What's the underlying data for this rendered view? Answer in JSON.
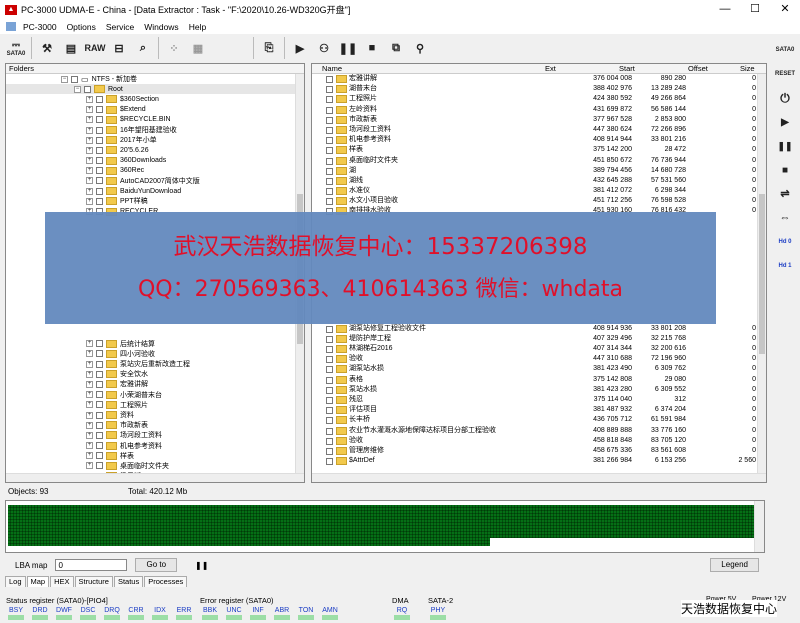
{
  "window": {
    "title": "PC-3000 UDMA-E - China - [Data Extractor : Task - \"F:\\2020\\10.26-WD320G开盘\"]"
  },
  "menu": {
    "items": [
      "PC-3000",
      "Options",
      "Service",
      "Windows",
      "Help"
    ]
  },
  "toolbar": {
    "sata_label": "SATA0",
    "raw_label": "RAW"
  },
  "right_bar": {
    "sata_label": "SATA0",
    "reset_label": "RESET",
    "hd0": "Hd 0",
    "hd1": "Hd 1"
  },
  "folders": {
    "header": "Folders",
    "drive": "NTFS - 新加卷",
    "root": "Root",
    "items_top": [
      "$360Section",
      "$Extend",
      "$RECYCLE.BIN",
      "16年望阳基建验收",
      "2017年小单",
      "20'5.6.26",
      "360Downloads",
      "360Rec",
      "AutoCAD2007简体中文版",
      "BaiduYunDownload",
      "PPT样稿",
      "RECYCLER"
    ],
    "items_bottom": [
      "后统计结算",
      "四小河验收",
      "泵站灾后重新改造工程",
      "安全饮水",
      "宏雅讲解",
      "小荣湖普末台",
      "工程照片",
      "资料",
      "市政新表",
      "场河段工资料",
      "机电参考资料",
      "样表",
      "桌面临时文件夹",
      "梁子湖"
    ]
  },
  "files": {
    "columns": {
      "name": "Name",
      "ext": "Ext",
      "start": "Start",
      "offset": "Offset",
      "size": "Size"
    },
    "rows_top": [
      {
        "name": "宏雅讲解",
        "start": "376 004 008",
        "offset": "890 280",
        "size": "0"
      },
      {
        "name": "湖普末台",
        "start": "388 402 976",
        "offset": "13 289 248",
        "size": "0"
      },
      {
        "name": "工程照片",
        "start": "424 380 592",
        "offset": "49 266 864",
        "size": "0"
      },
      {
        "name": "左岭资料",
        "start": "431 699 872",
        "offset": "56 586 144",
        "size": "0"
      },
      {
        "name": "市政新表",
        "start": "377 967 528",
        "offset": "2 853 800",
        "size": "0"
      },
      {
        "name": "场河段工资料",
        "start": "447 380 624",
        "offset": "72 266 896",
        "size": "0"
      },
      {
        "name": "机电参考资料",
        "start": "408 914 944",
        "offset": "33 801 216",
        "size": "0"
      },
      {
        "name": "样表",
        "start": "375 142 200",
        "offset": "28 472",
        "size": "0"
      },
      {
        "name": "桌面临时文件夹",
        "start": "451 850 672",
        "offset": "76 736 944",
        "size": "0"
      },
      {
        "name": "湖",
        "start": "389 794 456",
        "offset": "14 680 728",
        "size": "0"
      },
      {
        "name": "湖线",
        "start": "432 645 288",
        "offset": "57 531 560",
        "size": "0"
      },
      {
        "name": "水准仪",
        "start": "381 412 072",
        "offset": "6 298 344",
        "size": "0"
      },
      {
        "name": "水文小项目验收",
        "start": "451 712 256",
        "offset": "76 598 528",
        "size": "0"
      },
      {
        "name": "南排排水验收",
        "start": "451 930 160",
        "offset": "76 816 432",
        "size": "0"
      }
    ],
    "rows_bottom": [
      {
        "name": "湖泵站修复工程验收文件",
        "start": "408 914 936",
        "offset": "33 801 208",
        "size": "0"
      },
      {
        "name": "堤防护岸工程",
        "start": "407 329 496",
        "offset": "32 215 768",
        "size": "0"
      },
      {
        "name": "林湖梯石2016",
        "start": "407 314 344",
        "offset": "32 200 616",
        "size": "0"
      },
      {
        "name": "验收",
        "start": "447 310 688",
        "offset": "72 196 960",
        "size": "0"
      },
      {
        "name": "湖泵站水损",
        "start": "381 423 490",
        "offset": "6 309 762",
        "size": "0"
      },
      {
        "name": "表格",
        "start": "375 142 808",
        "offset": "29 080",
        "size": "0"
      },
      {
        "name": "泵站水损",
        "start": "381 423 280",
        "offset": "6 309 552",
        "size": "0"
      },
      {
        "name": "残忍",
        "start": "375 114 040",
        "offset": "312",
        "size": "0"
      },
      {
        "name": "评估项目",
        "start": "381 487 932",
        "offset": "6 374 204",
        "size": "0"
      },
      {
        "name": "长丰桥",
        "start": "436 705 712",
        "offset": "61 591 984",
        "size": "0"
      },
      {
        "name": "农业节水灌溉水源地保障达标项目分部工程验收",
        "start": "408 889 888",
        "offset": "33 776 160",
        "size": "0"
      },
      {
        "name": "验收",
        "start": "458 818 848",
        "offset": "83 705 120",
        "size": "0"
      },
      {
        "name": "管理房维修",
        "start": "458 675 336",
        "offset": "83 561 608",
        "size": "0"
      },
      {
        "name": "$AttrDef",
        "start": "381 266 984",
        "offset": "6 153 256",
        "size": "2 560"
      }
    ]
  },
  "banner": {
    "line1": "武汉天浩数据恢复中心：15337206398",
    "line2": "QQ：270569363、410614363   微信：whdata"
  },
  "status": {
    "objects": "Objects: 93",
    "total": "Total: 420.12 Mb"
  },
  "lba": {
    "label": "LBA map",
    "value": "0",
    "goto_label": "Go to",
    "legend_label": "Legend"
  },
  "tabs": [
    "Log",
    "Map",
    "HEX",
    "Structure",
    "Status",
    "Processes"
  ],
  "registers": {
    "status_caption": "Status register (SATA0)-[PIO4]",
    "status_leds": [
      "BSY",
      "DRD",
      "DWF",
      "DSC",
      "DRQ",
      "CRR",
      "IDX",
      "ERR"
    ],
    "error_caption": "Error register (SATA0)",
    "error_leds": [
      "BBK",
      "UNC",
      "INF",
      "ABR",
      "TON",
      "AMN"
    ],
    "dma_caption": "DMA",
    "dma_leds": [
      "RQ"
    ],
    "sata2_caption": "SATA-2",
    "sata2_leds": [
      "PHY"
    ],
    "power5": "Power 5V",
    "power12": "Power 12V",
    "v5": "5V",
    "v12": "12V"
  },
  "watermark": "天浩数据恢复中心",
  "colors": {
    "map_green": "#24a84a",
    "banner_bg": "#6389be",
    "banner_text": "#e0102a"
  }
}
